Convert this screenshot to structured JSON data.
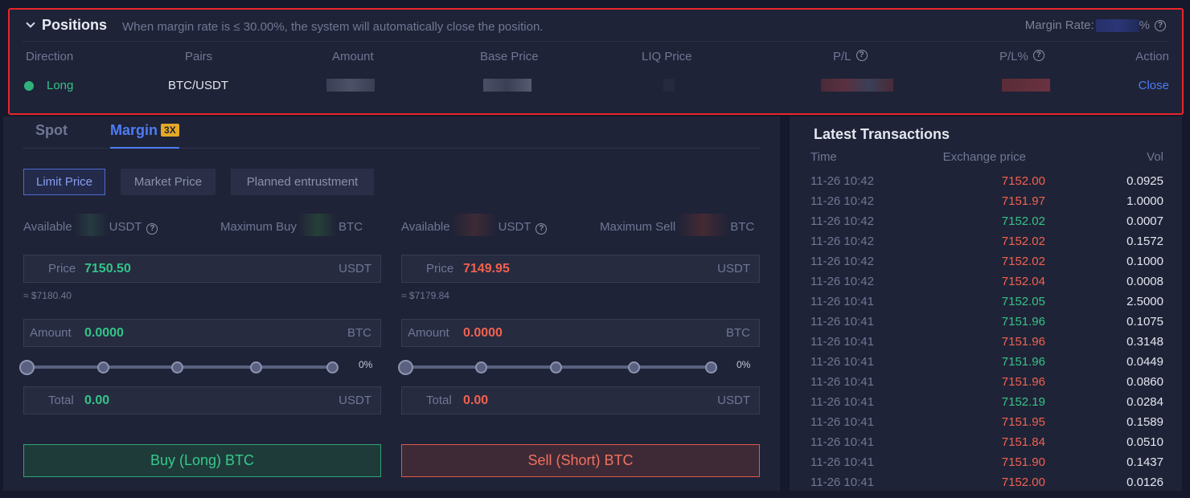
{
  "positions": {
    "title": "Positions",
    "note": "When margin rate is ≤ 30.00%, the system will automatically close the position.",
    "margin_rate_label": "Margin Rate:",
    "margin_rate_suffix": "%",
    "columns": [
      "Direction",
      "Pairs",
      "Amount",
      "Base Price",
      "LIQ Price",
      "P/L",
      "P/L%",
      "Action"
    ],
    "row": {
      "direction": "Long",
      "pair": "BTC/USDT",
      "action": "Close"
    }
  },
  "trade": {
    "tabs": {
      "spot": "Spot",
      "margin": "Margin",
      "leverage": "3X"
    },
    "order_types": [
      "Limit Price",
      "Market Price",
      "Planned entrustment"
    ],
    "buy": {
      "available_label": "Available",
      "available_unit": "USDT",
      "max_label": "Maximum Buy",
      "max_unit": "BTC",
      "price_label": "Price",
      "price": "7150.50",
      "price_unit": "USDT",
      "approx": "≈ $7180.40",
      "amount_label": "Amount",
      "amount": "0.0000",
      "amount_unit": "BTC",
      "percent": "0%",
      "total_label": "Total",
      "total": "0.00",
      "total_unit": "USDT",
      "button": "Buy (Long) BTC"
    },
    "sell": {
      "available_label": "Available",
      "available_unit": "USDT",
      "max_label": "Maximum Sell",
      "max_unit": "BTC",
      "price_label": "Price",
      "price": "7149.95",
      "price_unit": "USDT",
      "approx": "≈ $7179.84",
      "amount_label": "Amount",
      "amount": "0.0000",
      "amount_unit": "BTC",
      "percent": "0%",
      "total_label": "Total",
      "total": "0.00",
      "total_unit": "USDT",
      "button": "Sell (Short) BTC"
    }
  },
  "latest": {
    "title": "Latest Transactions",
    "headers": {
      "time": "Time",
      "price": "Exchange price",
      "vol": "Vol"
    },
    "rows": [
      {
        "time": "11-26 10:42",
        "price": "7152.00",
        "side": "sell",
        "vol": "0.0925"
      },
      {
        "time": "11-26 10:42",
        "price": "7151.97",
        "side": "sell",
        "vol": "1.0000"
      },
      {
        "time": "11-26 10:42",
        "price": "7152.02",
        "side": "buy",
        "vol": "0.0007"
      },
      {
        "time": "11-26 10:42",
        "price": "7152.02",
        "side": "sell",
        "vol": "0.1572"
      },
      {
        "time": "11-26 10:42",
        "price": "7152.02",
        "side": "sell",
        "vol": "0.1000"
      },
      {
        "time": "11-26 10:42",
        "price": "7152.04",
        "side": "sell",
        "vol": "0.0008"
      },
      {
        "time": "11-26 10:41",
        "price": "7152.05",
        "side": "buy",
        "vol": "2.5000"
      },
      {
        "time": "11-26 10:41",
        "price": "7151.96",
        "side": "buy",
        "vol": "0.1075"
      },
      {
        "time": "11-26 10:41",
        "price": "7151.96",
        "side": "sell",
        "vol": "0.3148"
      },
      {
        "time": "11-26 10:41",
        "price": "7151.96",
        "side": "buy",
        "vol": "0.0449"
      },
      {
        "time": "11-26 10:41",
        "price": "7151.96",
        "side": "sell",
        "vol": "0.0860"
      },
      {
        "time": "11-26 10:41",
        "price": "7152.19",
        "side": "buy",
        "vol": "0.0284"
      },
      {
        "time": "11-26 10:41",
        "price": "7151.95",
        "side": "sell",
        "vol": "0.1589"
      },
      {
        "time": "11-26 10:41",
        "price": "7151.84",
        "side": "sell",
        "vol": "0.0510"
      },
      {
        "time": "11-26 10:41",
        "price": "7151.90",
        "side": "sell",
        "vol": "0.1437"
      },
      {
        "time": "11-26 10:41",
        "price": "7152.00",
        "side": "sell",
        "vol": "0.0126"
      }
    ]
  },
  "colors": {
    "buy": "#33c487",
    "sell": "#f2614e",
    "accent": "#4e7cf5",
    "highlight_border": "#e8262b"
  }
}
